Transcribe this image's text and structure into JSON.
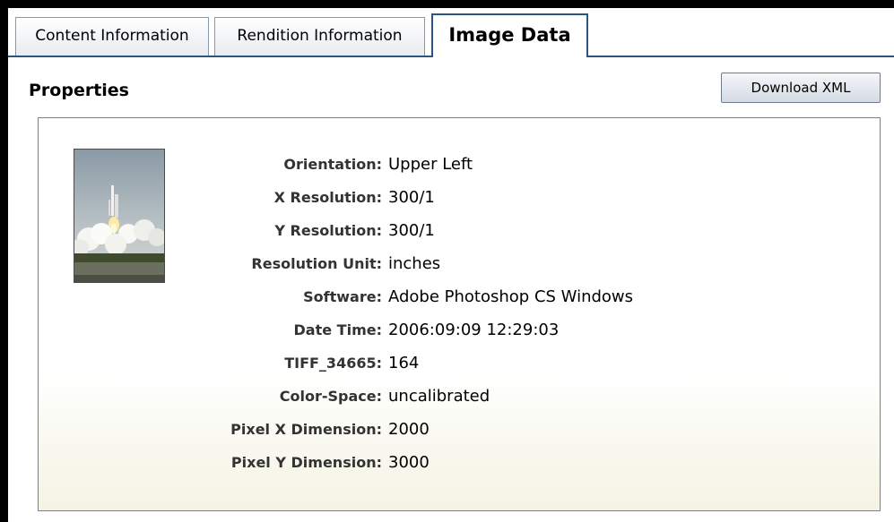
{
  "tabs": [
    {
      "label": "Content Information"
    },
    {
      "label": "Rendition Information"
    },
    {
      "label": "Image Data"
    }
  ],
  "properties": {
    "title": "Properties",
    "download_label": "Download XML",
    "rows": [
      {
        "label": "Orientation",
        "value": "Upper Left"
      },
      {
        "label": "X Resolution",
        "value": "300/1"
      },
      {
        "label": "Y Resolution",
        "value": "300/1"
      },
      {
        "label": "Resolution Unit",
        "value": "inches"
      },
      {
        "label": "Software",
        "value": "Adobe Photoshop CS Windows"
      },
      {
        "label": "Date Time",
        "value": "2006:09:09 12:29:03"
      },
      {
        "label": "TIFF_34665",
        "value": "164"
      },
      {
        "label": "Color-Space",
        "value": "uncalibrated"
      },
      {
        "label": "Pixel X Dimension",
        "value": "2000"
      },
      {
        "label": "Pixel Y Dimension",
        "value": "3000"
      }
    ]
  },
  "colors": {
    "tab_border_active": "#2b5486",
    "panel_gradient_bottom": "#f4f3e3"
  }
}
